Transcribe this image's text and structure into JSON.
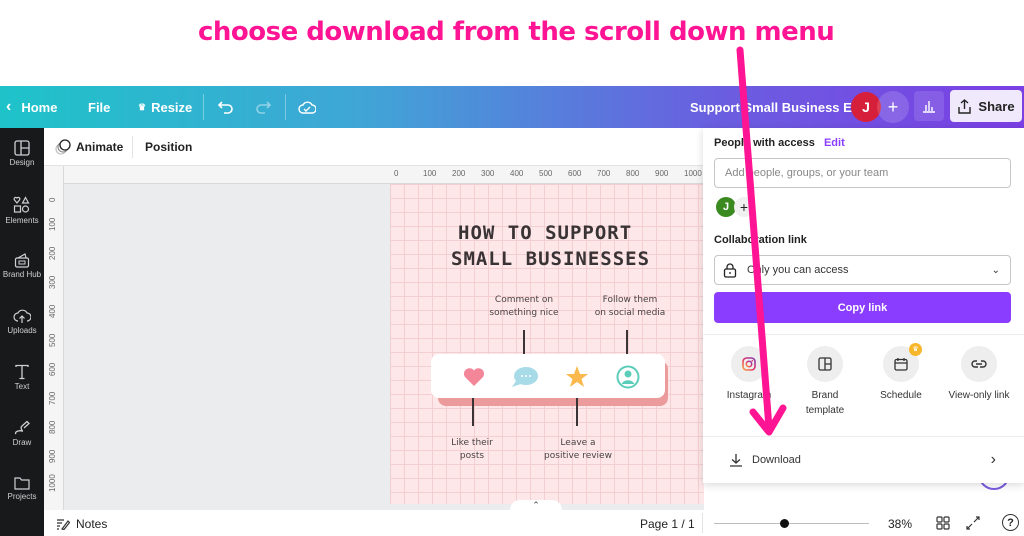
{
  "annotation": {
    "text": "choose download from the scroll down menu",
    "color": "#ff1493"
  },
  "topbar": {
    "home_label": "Home",
    "file_label": "File",
    "resize_label": "Resize",
    "doc_title": "Support Small Business EG",
    "avatar_initial": "J",
    "add_label": "+",
    "share_label": "Share"
  },
  "sidebar": {
    "items": [
      {
        "label": "Design",
        "icon": "layout-icon"
      },
      {
        "label": "Elements",
        "icon": "shapes-icon"
      },
      {
        "label": "Brand Hub",
        "icon": "brand-hub-icon"
      },
      {
        "label": "Uploads",
        "icon": "cloud-upload-icon"
      },
      {
        "label": "Text",
        "icon": "text-icon"
      },
      {
        "label": "Draw",
        "icon": "draw-icon"
      },
      {
        "label": "Projects",
        "icon": "folder-icon"
      }
    ]
  },
  "editor_toolbar": {
    "animate_label": "Animate",
    "position_label": "Position"
  },
  "rulers": {
    "top": [
      "0",
      "100",
      "200",
      "300",
      "400",
      "500",
      "600",
      "700",
      "800",
      "900",
      "1000"
    ],
    "left": [
      "0",
      "100",
      "200",
      "300",
      "400",
      "500",
      "600",
      "700",
      "800",
      "900",
      "1000"
    ]
  },
  "design": {
    "title_line1": "HOW TO SUPPORT",
    "title_line2": "SMALL BUSINESSES",
    "tip_comment_1": "Comment on",
    "tip_comment_2": "something nice",
    "tip_follow_1": "Follow them",
    "tip_follow_2": "on social media",
    "tip_like_1": "Like their",
    "tip_like_2": "posts",
    "tip_review_1": "Leave a",
    "tip_review_2": "positive review"
  },
  "share_panel": {
    "people_label": "People with access",
    "edit_label": "Edit",
    "add_people_placeholder": "Add people, groups, or your team",
    "member_initial": "J",
    "collab_label": "Collaboration link",
    "access_value": "Only you can access",
    "copy_link_label": "Copy link",
    "options": [
      {
        "label": "Instagram",
        "icon": "instagram-icon"
      },
      {
        "label": "Brand template",
        "icon": "brand-template-icon"
      },
      {
        "label": "Schedule",
        "icon": "calendar-icon"
      },
      {
        "label": "View-only link",
        "icon": "link-icon"
      }
    ],
    "download_label": "Download"
  },
  "bottombar": {
    "notes_label": "Notes",
    "page_label": "Page 1 / 1",
    "zoom_percent": "38%",
    "zoom_fraction": 0.38
  },
  "colors": {
    "accent_purple": "#8b3dff",
    "avatar_red": "#d61f3a",
    "member_green": "#3a8a1f"
  }
}
